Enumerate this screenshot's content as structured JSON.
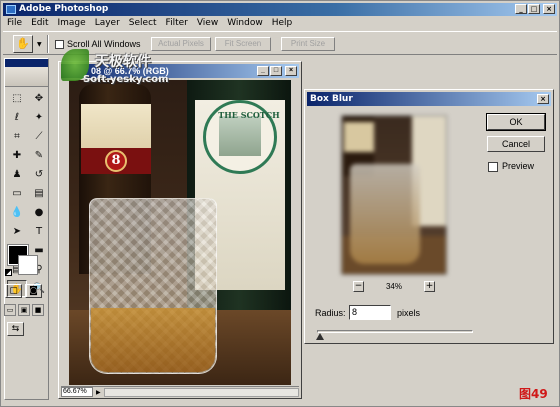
{
  "window": {
    "title": "Adobe Photoshop",
    "controls": {
      "minimize": "_",
      "maximize": "□",
      "close": "×"
    }
  },
  "menu": [
    "File",
    "Edit",
    "Image",
    "Layer",
    "Select",
    "Filter",
    "View",
    "Window",
    "Help"
  ],
  "options_bar": {
    "tool_icon": "hand-icon",
    "tool_glyph": "✋",
    "scroll_all_windows_label": "Scroll All Windows",
    "scroll_all_windows_checked": false,
    "actual_pixels_label": "Actual Pixels",
    "fit_screen_label": "Fit Screen",
    "print_size_label": "Print Size"
  },
  "toolbox": {
    "tools": [
      {
        "name": "marquee-tool",
        "glyph": "⬚"
      },
      {
        "name": "move-tool",
        "glyph": "✥"
      },
      {
        "name": "lasso-tool",
        "glyph": "ℓ"
      },
      {
        "name": "magic-wand-tool",
        "glyph": "✦"
      },
      {
        "name": "crop-tool",
        "glyph": "⌗"
      },
      {
        "name": "slice-tool",
        "glyph": "⟋"
      },
      {
        "name": "healing-brush-tool",
        "glyph": "✚"
      },
      {
        "name": "brush-tool",
        "glyph": "✎"
      },
      {
        "name": "clone-stamp-tool",
        "glyph": "♟"
      },
      {
        "name": "history-brush-tool",
        "glyph": "↺"
      },
      {
        "name": "eraser-tool",
        "glyph": "▭"
      },
      {
        "name": "gradient-tool",
        "glyph": "▤"
      },
      {
        "name": "blur-tool",
        "glyph": "💧"
      },
      {
        "name": "dodge-tool",
        "glyph": "●"
      },
      {
        "name": "path-selection-tool",
        "glyph": "➤"
      },
      {
        "name": "type-tool",
        "glyph": "T"
      },
      {
        "name": "pen-tool",
        "glyph": "✒"
      },
      {
        "name": "shape-tool",
        "glyph": "▬"
      },
      {
        "name": "notes-tool",
        "glyph": "▤"
      },
      {
        "name": "eyedropper-tool",
        "glyph": "⚲"
      },
      {
        "name": "hand-tool",
        "glyph": "✋"
      },
      {
        "name": "zoom-tool",
        "glyph": "🔍"
      }
    ],
    "selected_tool": "hand-tool"
  },
  "document": {
    "title": "08 @ 66.7% (RGB)",
    "zoom": "66.67%",
    "photo_labels": {
      "scotch_society": "THE SCOTCH",
      "age_badge": "8"
    }
  },
  "watermark": {
    "cn": "天极软件",
    "url": "Soft.yesky.com"
  },
  "dialog": {
    "title": "Box Blur",
    "ok_label": "OK",
    "cancel_label": "Cancel",
    "preview_label": "Preview",
    "preview_checked": false,
    "zoom_minus": "−",
    "zoom_plus": "+",
    "zoom_percent": "34%",
    "radius_label": "Radius:",
    "radius_value": "8",
    "radius_unit": "pixels",
    "radius_slider_position": 0.02
  },
  "figure_label": "图49",
  "colors": {
    "title_start": "#0a246a",
    "title_end": "#a6caf0",
    "panel": "#d4d0c8",
    "figure_label": "#d01818"
  }
}
